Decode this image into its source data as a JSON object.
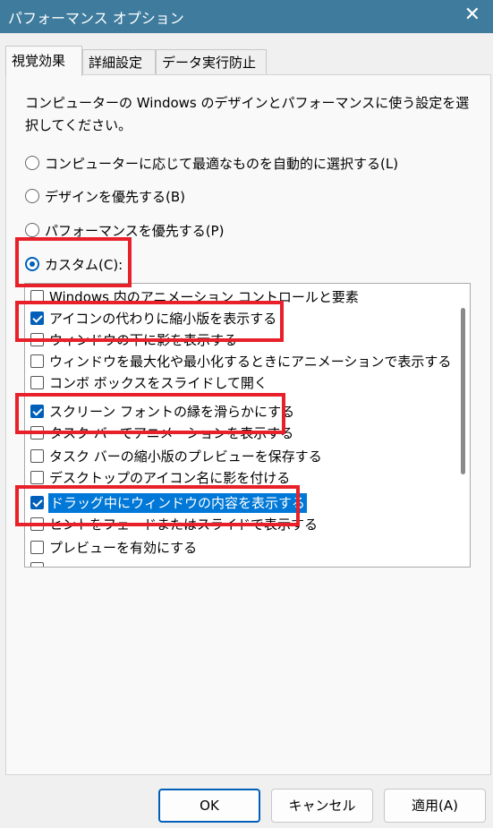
{
  "window": {
    "title": "パフォーマンス オプション",
    "close_glyph": "✕"
  },
  "tabs": [
    {
      "label": "視覚効果",
      "active": true
    },
    {
      "label": "詳細設定",
      "active": false
    },
    {
      "label": "データ実行防止",
      "active": false
    }
  ],
  "description": "コンピューターの Windows のデザインとパフォーマンスに使う設定を選択してください。",
  "radios": [
    {
      "label": "コンピューターに応じて最適なものを自動的に選択する(L)",
      "checked": false
    },
    {
      "label": "デザインを優先する(B)",
      "checked": false
    },
    {
      "label": "パフォーマンスを優先する(P)",
      "checked": false
    },
    {
      "label": "カスタム(C):",
      "checked": true
    }
  ],
  "effects": [
    {
      "label": "Windows 内のアニメーション コントロールと要素",
      "checked": false
    },
    {
      "label": "アイコンの代わりに縮小版を表示する",
      "checked": true
    },
    {
      "label": "ウィンドウの下に影を表示する",
      "checked": false
    },
    {
      "label": "ウィンドウを最大化や最小化するときにアニメーションで表示する",
      "checked": false
    },
    {
      "label": "コンボ ボックスをスライドして開く",
      "checked": false
    },
    {
      "label": "スクリーン フォントの縁を滑らかにする",
      "checked": true
    },
    {
      "label": "タスク バーでアニメーションを表示する",
      "checked": false
    },
    {
      "label": "タスク バーの縮小版のプレビューを保存する",
      "checked": false
    },
    {
      "label": "デスクトップのアイコン名に影を付ける",
      "checked": false
    },
    {
      "label": "ドラッグ中にウィンドウの内容を表示する",
      "checked": true,
      "selected": true
    },
    {
      "label": "ヒントをフェードまたはスライドで表示する",
      "checked": false
    },
    {
      "label": "プレビューを有効にする",
      "checked": false
    },
    {
      "label": "",
      "checked": false
    }
  ],
  "buttons": {
    "ok": "OK",
    "cancel": "キャンセル",
    "apply": "適用(A)"
  },
  "colors": {
    "titlebar": "#3e7b9d",
    "accent": "#005fb8",
    "selection": "#0078d7",
    "highlight_box": "#e8202a"
  }
}
